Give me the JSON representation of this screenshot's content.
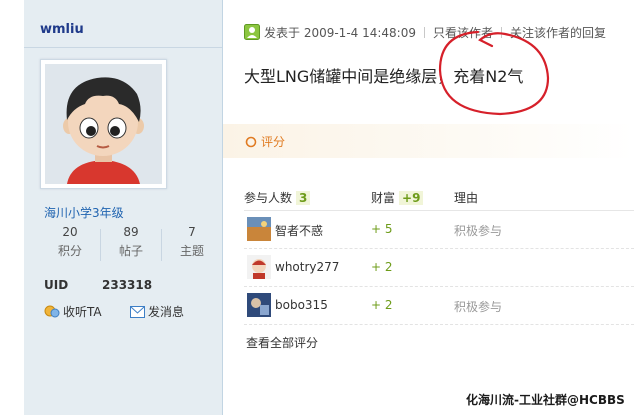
{
  "author": {
    "name": "wmliu",
    "level": "海川小学3年级",
    "stats": [
      {
        "value": "20",
        "label": "积分"
      },
      {
        "value": "89",
        "label": "帖子"
      },
      {
        "value": "7",
        "label": "主题"
      }
    ],
    "uid_label": "UID",
    "uid_value": "233318",
    "follow_label": "收听TA",
    "message_label": "发消息"
  },
  "post": {
    "posted_at": "发表于 2009-1-4 14:48:09",
    "only_author": "只看该作者",
    "follow_author_replies": "关注该作者的回复",
    "content": "大型LNG储罐中间是绝缘层，充着N2气"
  },
  "rating": {
    "label": "评分",
    "header": {
      "participants_label": "参与人数",
      "participants_count": "3",
      "wealth_label": "财富",
      "wealth_total": "+9",
      "reason_label": "理由"
    },
    "rows": [
      {
        "user": "智者不惑",
        "value": "+ 5",
        "reason": "积极参与"
      },
      {
        "user": "whotry277",
        "value": "+ 2",
        "reason": ""
      },
      {
        "user": "bobo315",
        "value": "+ 2",
        "reason": "积极参与"
      }
    ],
    "view_all": "查看全部评分"
  },
  "watermark": "化海川流-工业社群@HCBBS",
  "colors": {
    "sidebar_bg": "#e5edf2",
    "link_blue": "#1f63b0",
    "wealth_green": "#6e9c1a",
    "rate_orange": "#e07b22",
    "annotation_red": "#d6202a"
  }
}
